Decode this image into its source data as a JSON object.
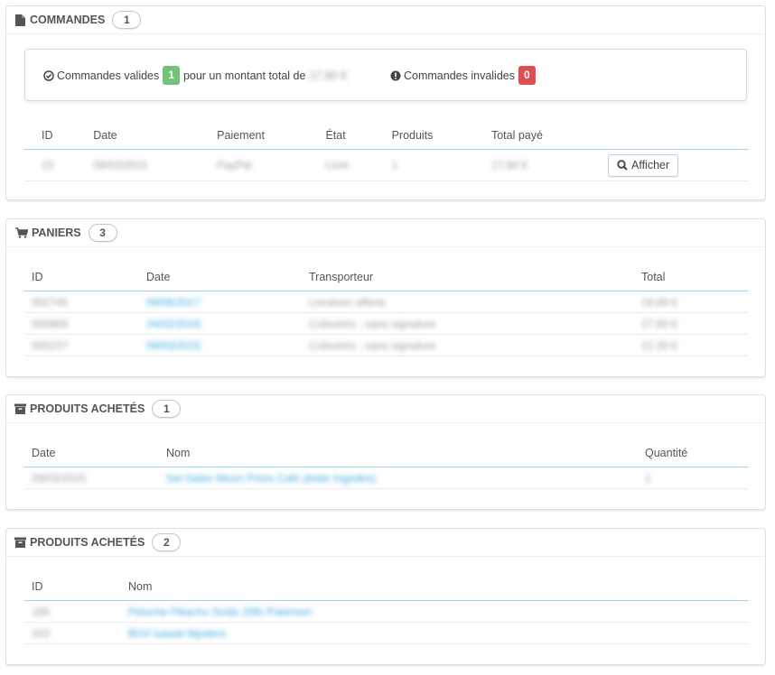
{
  "orders": {
    "title": "COMMANDES",
    "count": "1",
    "valid_label": "Commandes valides",
    "valid_count": "1",
    "amount_label": "pour un montant total de",
    "amount_value": "17,80 €",
    "invalid_label": "Commandes invalides",
    "invalid_count": "0",
    "columns": [
      "ID",
      "Date",
      "Paiement",
      "État",
      "Produits",
      "Total payé"
    ],
    "rows": [
      {
        "id": "23",
        "date": "09/03/2015",
        "payment": "PayPal",
        "state": "Livré",
        "products": "1",
        "total": "17,80 €",
        "action": "Afficher"
      }
    ]
  },
  "carts": {
    "title": "PANIERS",
    "count": "3",
    "columns": [
      "ID",
      "Date",
      "Transporteur",
      "Total"
    ],
    "rows": [
      {
        "id": "002745",
        "date": "09/06/2017",
        "carrier": "Livraison offerte",
        "total": "19,99 €"
      },
      {
        "id": "000869",
        "date": "24/02/2016",
        "carrier": "Colissimo - sans signature",
        "total": "27,90 €"
      },
      {
        "id": "000237",
        "date": "09/03/2015",
        "carrier": "Colissimo - sans signature",
        "total": "12,30 €"
      }
    ]
  },
  "purchased": {
    "title": "PRODUITS ACHETÉS",
    "count": "1",
    "columns": [
      "Date",
      "Nom",
      "Quantité"
    ],
    "rows": [
      {
        "date": "09/03/2015",
        "name": "Set Sailor Moon Prism Cafe (boite Ingedire)",
        "qty": "1"
      }
    ]
  },
  "purchased2": {
    "title": "PRODUITS ACHETÉS",
    "count": "2",
    "columns": [
      "ID",
      "Nom"
    ],
    "rows": [
      {
        "id": "185",
        "name": "Peluche Pikachu Smile 20th Pokémon"
      },
      {
        "id": "203",
        "name": "BOX kawaii Mystère"
      }
    ]
  }
}
